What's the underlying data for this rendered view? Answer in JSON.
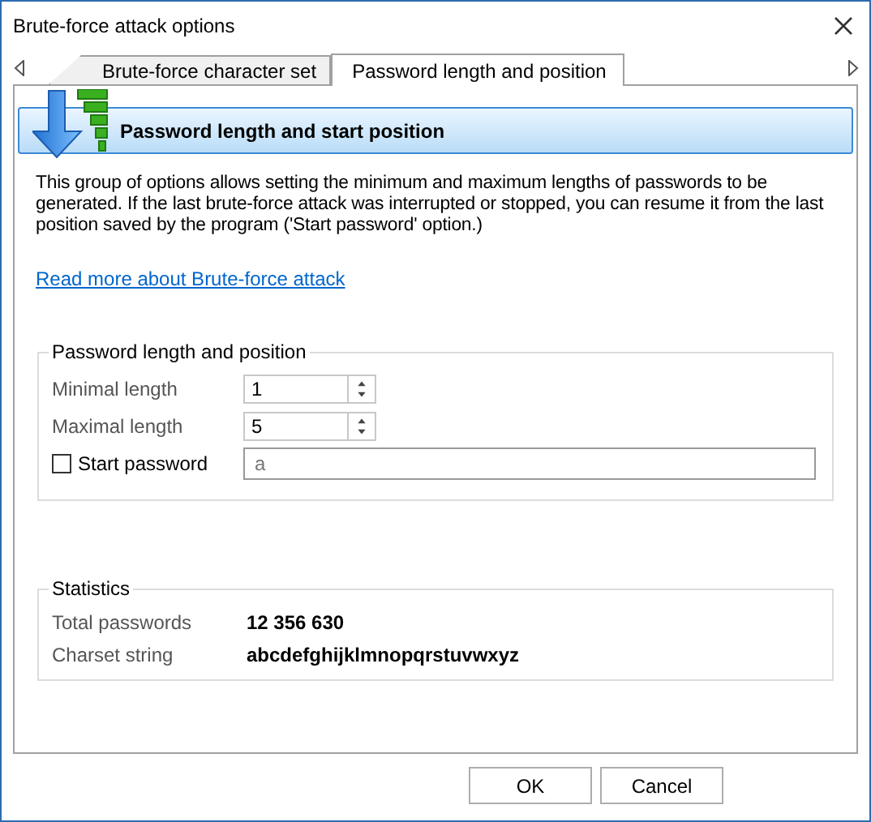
{
  "window": {
    "title": "Brute-force attack options"
  },
  "tabs": [
    {
      "label": "Brute-force character set",
      "selected": false
    },
    {
      "label": "Password length and position",
      "selected": true
    }
  ],
  "header": {
    "title": "Password length and start position"
  },
  "description": "This group of options allows setting the minimum and maximum lengths of passwords to be generated. If the last brute-force attack was interrupted or stopped, you can resume it from the last position saved by the program ('Start password' option.)",
  "link": "Read more about Brute-force attack",
  "length_group": {
    "title": "Password length and position",
    "fields": [
      {
        "kind": "spin",
        "label": "Minimal length",
        "value": "1"
      },
      {
        "kind": "spin",
        "label": "Maximal length",
        "value": "5"
      },
      {
        "kind": "check",
        "label": "Start password",
        "checked": false,
        "value": "a"
      }
    ]
  },
  "statistics": {
    "title": "Statistics",
    "rows": [
      {
        "label": "Total passwords",
        "value": "12 356 630"
      },
      {
        "label": "Charset string",
        "value": "abcdefghijklmnopqrstuvwxyz"
      }
    ]
  },
  "buttons": [
    "OK",
    "Cancel"
  ]
}
